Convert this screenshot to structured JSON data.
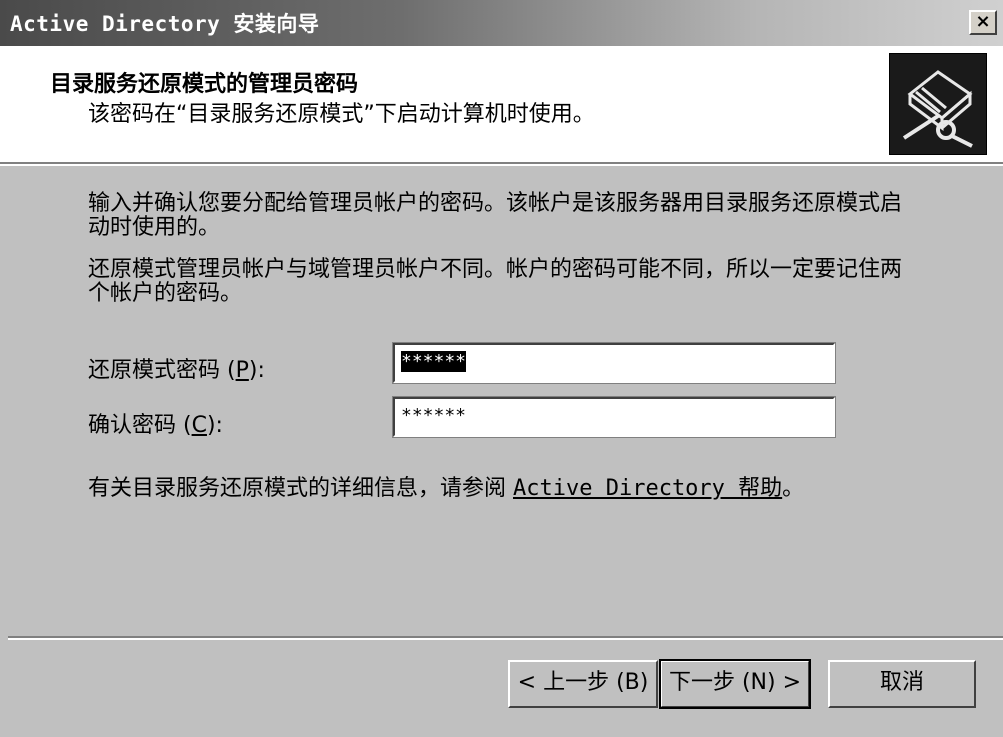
{
  "window": {
    "title": "Active Directory 安装向导",
    "close_glyph": "×"
  },
  "header": {
    "title": "目录服务还原模式的管理员密码",
    "subtitle": "该密码在“目录服务还原模式”下启动计算机时使用。",
    "icon": "wizard-book-key-icon"
  },
  "body": {
    "paragraph1": "输入并确认您要分配给管理员帐户的密码。该帐户是该服务器用目录服务还原模式启动时使用的。",
    "paragraph2": "还原模式管理员帐户与域管理员帐户不同。帐户的密码可能不同，所以一定要记住两个帐户的密码。",
    "password_label_pre": "还原模式密码 (",
    "password_label_key": "P",
    "password_label_post": "):",
    "password_value": "******",
    "confirm_label_pre": "确认密码 (",
    "confirm_label_key": "C",
    "confirm_label_post": "):",
    "confirm_value": "******",
    "help_text_pre": "有关目录服务还原模式的详细信息，请参阅 ",
    "help_link": "Active Directory 帮助",
    "help_text_post": "。"
  },
  "buttons": {
    "back": "< 上一步 (B)",
    "next": "下一步 (N) >",
    "cancel": "取消"
  }
}
